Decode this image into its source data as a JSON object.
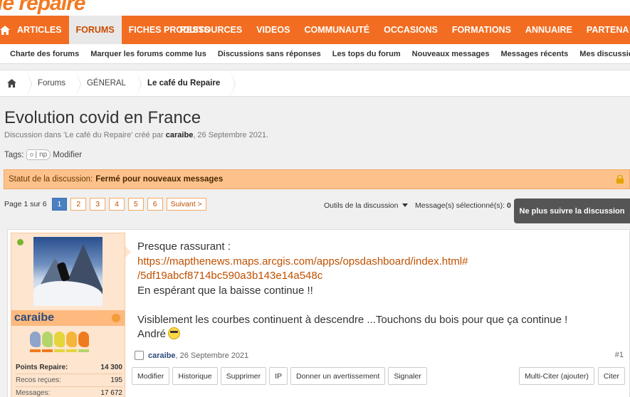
{
  "logo": {
    "text": "le repaire"
  },
  "main_nav": {
    "home_icon": "home-icon",
    "items": [
      {
        "label": "ARTICLES",
        "active": false
      },
      {
        "label": "FORUMS",
        "active": true
      },
      {
        "label": "FICHES PRODUITS",
        "active": false
      },
      {
        "label": "RESSOURCES",
        "active": false
      },
      {
        "label": "VIDEOS",
        "active": false
      },
      {
        "label": "COMMUNAUTÉ",
        "active": false
      },
      {
        "label": "OCCASIONS",
        "active": false
      },
      {
        "label": "FORMATIONS",
        "active": false
      },
      {
        "label": "ANNUAIRE",
        "active": false
      },
      {
        "label": "PARTENA",
        "active": false
      }
    ]
  },
  "sub_nav": {
    "items": [
      "Charte des forums",
      "Marquer les forums comme lus",
      "Discussions sans réponses",
      "Les tops du forum",
      "Nouveaux messages",
      "Messages récents",
      "Mes discussions suivies"
    ]
  },
  "breadcrumb": {
    "home_icon": "home-icon",
    "items": [
      "Forums",
      "GÉNERAL",
      "Le café du Repaire"
    ]
  },
  "thread": {
    "title": "Evolution covid en France",
    "meta_prefix": "Discussion dans 'Le café du Repaire' créé par ",
    "author": "caraibe",
    "meta_suffix": ", 26 Septembre 2021.",
    "tags_label": "Tags:",
    "tag_value": "np",
    "tags_edit": "Modifier"
  },
  "status": {
    "label": "Statut de la discussion:",
    "value": "Fermé pour nouveaux messages",
    "icon": "lock-icon"
  },
  "pagination": {
    "label": "Page 1 sur 6",
    "pages": [
      "1",
      "2",
      "3",
      "4",
      "5",
      "6"
    ],
    "current": "1",
    "next": "Suivant >"
  },
  "toolbar": {
    "tools_label": "Outils de la discussion",
    "selected_label": "Message(s) sélectionné(s):",
    "selected_count": "0",
    "unfollow": "Ne plus suivre la discussion"
  },
  "post": {
    "user": {
      "name": "caraibe",
      "online": true,
      "rank_colors": [
        "#8fa4c9",
        "#b4d56b",
        "#e3d53b",
        "#f6b53a",
        "#f07b1f"
      ],
      "rank_line_colors": [
        "#f07b1f",
        "#f07b1f",
        "#e3d53b",
        "#e3d53b",
        "#b4d56b"
      ],
      "stats": [
        {
          "label": "Points Repaire:",
          "value": "14 300"
        },
        {
          "label": "Recos reçues:",
          "value": "195"
        },
        {
          "label": "Messages:",
          "value": "17 672"
        }
      ]
    },
    "body": {
      "line1": "Presque rassurant :",
      "link_line1": "https://mapthenews.maps.arcgis.com/apps/opsdashboard/index.html#",
      "link_line2": "/5df19abcf8714bc590a3b143e14a548c",
      "line2": "En espérant que la baisse continue !!",
      "line3": "Visiblement les courbes continuent à descendre ...Touchons du bois pour que ça continue !",
      "signature": "André"
    },
    "meta": {
      "author": "caraibe",
      "date": ", 26 Septembre 2021",
      "number": "#1"
    },
    "actions": [
      "Modifier",
      "Historique",
      "Supprimer",
      "IP",
      "Donner un avertissement",
      "Signaler"
    ],
    "actions_right": [
      "Multi-Citer (ajouter)",
      "Citer"
    ]
  }
}
